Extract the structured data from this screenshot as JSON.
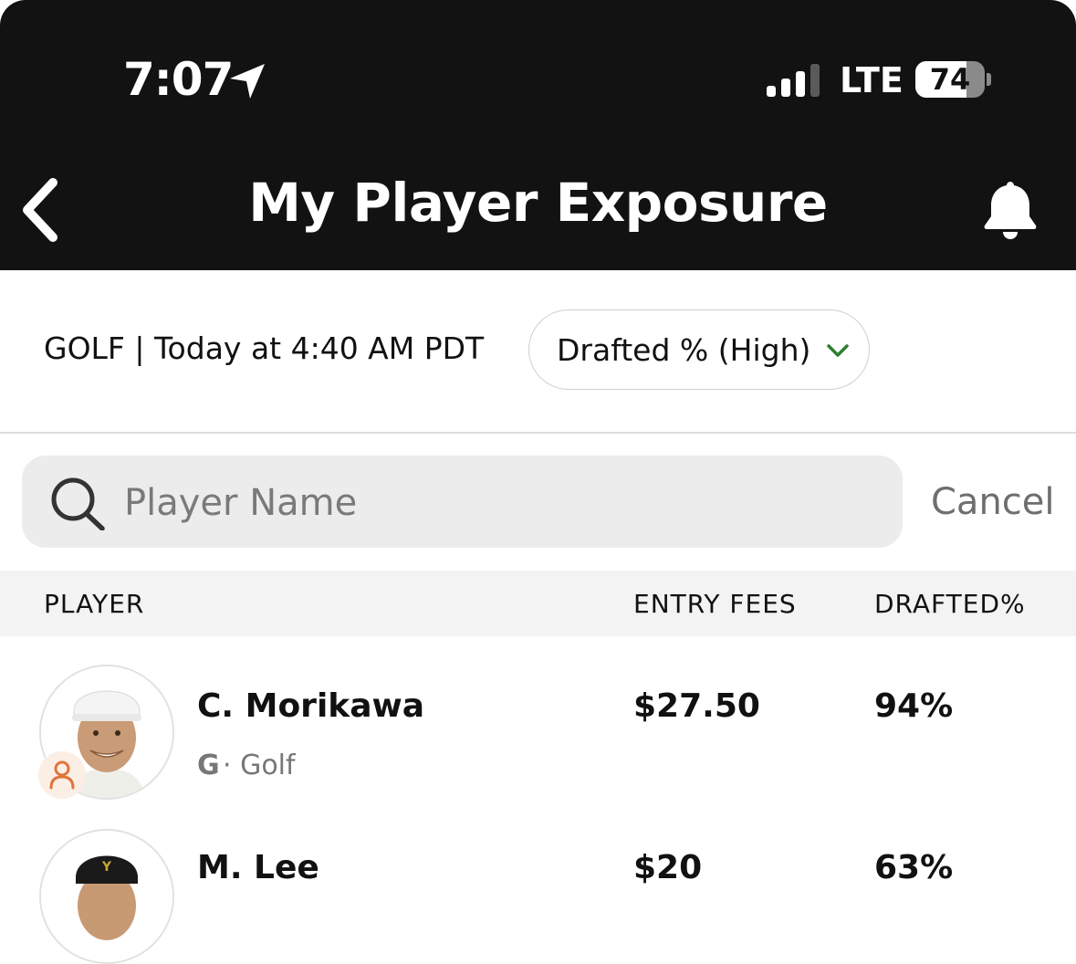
{
  "status_bar": {
    "time": "7:07",
    "network": "LTE",
    "battery": "74",
    "battery_level": 0.74,
    "signal_bars": 3
  },
  "header": {
    "title": "My Player Exposure"
  },
  "contest": {
    "info": "GOLF | Today at 4:40 AM PDT",
    "sort": "Drafted % (High)"
  },
  "search": {
    "placeholder": "Player Name",
    "cancel_label": "Cancel"
  },
  "table": {
    "columns": [
      "PLAYER",
      "ENTRY FEES",
      "DRAFTED%"
    ],
    "rows": [
      {
        "name": "C. Morikawa",
        "position": "G",
        "sport": "Golf",
        "entry_fees": "$27.50",
        "drafted": "94%"
      },
      {
        "name": "M. Lee",
        "position": "",
        "sport": "",
        "entry_fees": "$20",
        "drafted": "63%"
      }
    ]
  },
  "colors": {
    "header_bg": "#121212",
    "accent_green": "#2e7d32",
    "badge_orange": "#e0743a"
  }
}
